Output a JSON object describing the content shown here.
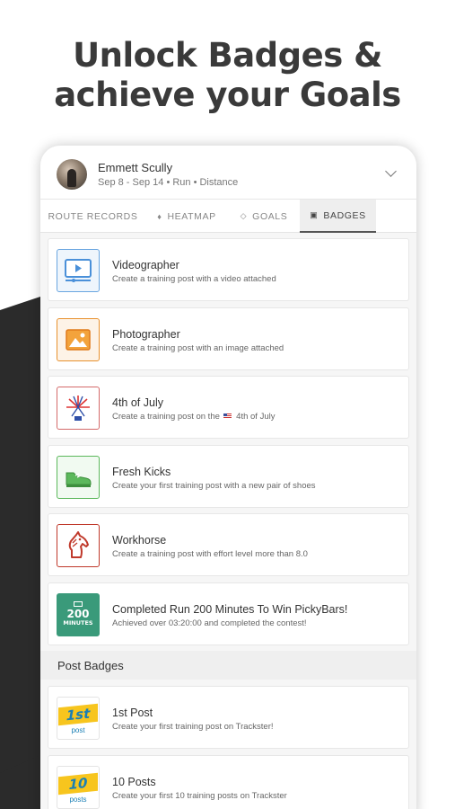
{
  "headline": {
    "line1": "Unlock Badges &",
    "line2": "achieve your Goals"
  },
  "profile": {
    "name": "Emmett Scully",
    "subtitle": "Sep 8 - Sep 14 • Run • Distance"
  },
  "tabs": [
    {
      "label": "ROUTE RECORDS",
      "icon": ""
    },
    {
      "label": "HEATMAP",
      "icon": "flame-icon"
    },
    {
      "label": "GOALS",
      "icon": "target-icon"
    },
    {
      "label": "BADGES",
      "icon": "badge-icon",
      "active": true
    }
  ],
  "badges": [
    {
      "title": "Videographer",
      "desc": "Create a training post with a video attached",
      "icon": "video-icon",
      "color": "#4a90d9"
    },
    {
      "title": "Photographer",
      "desc": "Create a training post with an image attached",
      "icon": "image-icon",
      "color": "#e8912e"
    },
    {
      "title": "4th of July",
      "desc_pre": "Create a training post on the",
      "desc_post": "4th of July",
      "icon": "fireworks-icon",
      "color": "#d04a4a"
    },
    {
      "title": "Fresh Kicks",
      "desc": "Create your first training post with a new pair of shoes",
      "icon": "shoe-icon",
      "color": "#4aa84a"
    },
    {
      "title": "Workhorse",
      "desc": "Create a training post with effort level more than 8.0",
      "icon": "horse-icon",
      "color": "#c0392b"
    },
    {
      "title": "Completed Run 200 Minutes To Win PickyBars!",
      "desc": "Achieved over 03:20:00 and completed the contest!",
      "icon": "contest-icon",
      "color": "#3a9a7a",
      "badge_line1": "200",
      "badge_line2": "MINUTES"
    }
  ],
  "post_badges_header": "Post Badges",
  "post_badges": [
    {
      "title": "1st Post",
      "desc": "Create your first training post on Trackster!",
      "badge_big": "1st",
      "badge_small": "post"
    },
    {
      "title": "10 Posts",
      "desc": "Create your first 10 training posts on Trackster",
      "badge_big": "10",
      "badge_small": "posts"
    }
  ]
}
